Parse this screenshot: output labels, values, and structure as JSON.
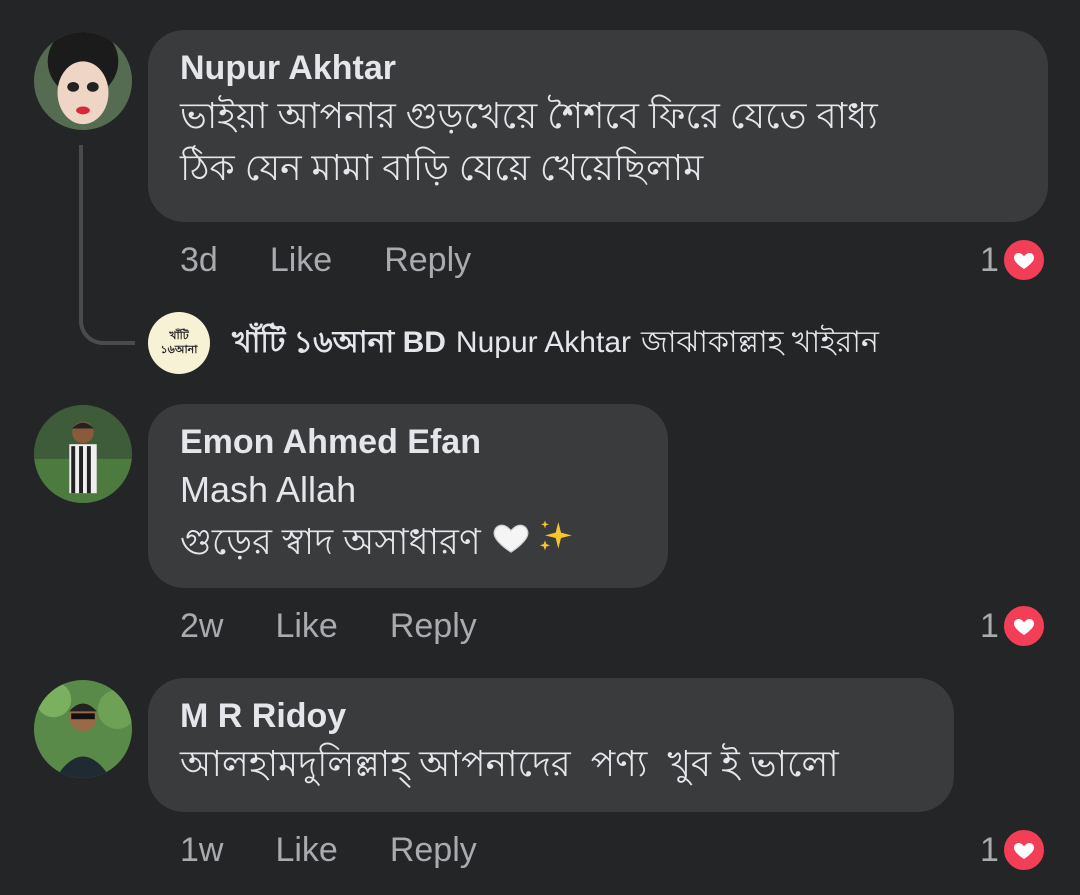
{
  "comments": [
    {
      "author": "Nupur Akhtar",
      "lines": [
        "ভাইয়া আপনার গুড়খেয়ে শৈশবে ফিরে যেতে বাধ্য",
        "ঠিক যেন মামা বাড়ি যেয়ে খেয়েছিলাম"
      ],
      "time": "3d",
      "like": "Like",
      "reply": "Reply",
      "reaction_count": "1"
    },
    {
      "author": "Emon Ahmed Efan",
      "lines": [
        "Mash Allah",
        "গুড়ের স্বাদ অসাধারণ"
      ],
      "emoji": [
        "white-heart",
        "sparkles"
      ],
      "time": "2w",
      "like": "Like",
      "reply": "Reply",
      "reaction_count": "1"
    },
    {
      "author": "M R Ridoy",
      "lines": [
        "আলহামদুলিল্লাহ্ আপনাদের  পণ্য  খুব ই ভালো"
      ],
      "time": "1w",
      "like": "Like",
      "reply": "Reply",
      "reaction_count": "1"
    }
  ],
  "reply": {
    "author": "খাঁটি ১৬আনা BD",
    "mention": "Nupur Akhtar",
    "text": "জাঝাকাল্লাহ খাইরান",
    "logo_text": [
      "খাঁটি",
      "১৬আনা"
    ]
  },
  "colors": {
    "background": "#242526",
    "bubble": "#3a3b3c",
    "reaction_heart": "#f33e58"
  }
}
